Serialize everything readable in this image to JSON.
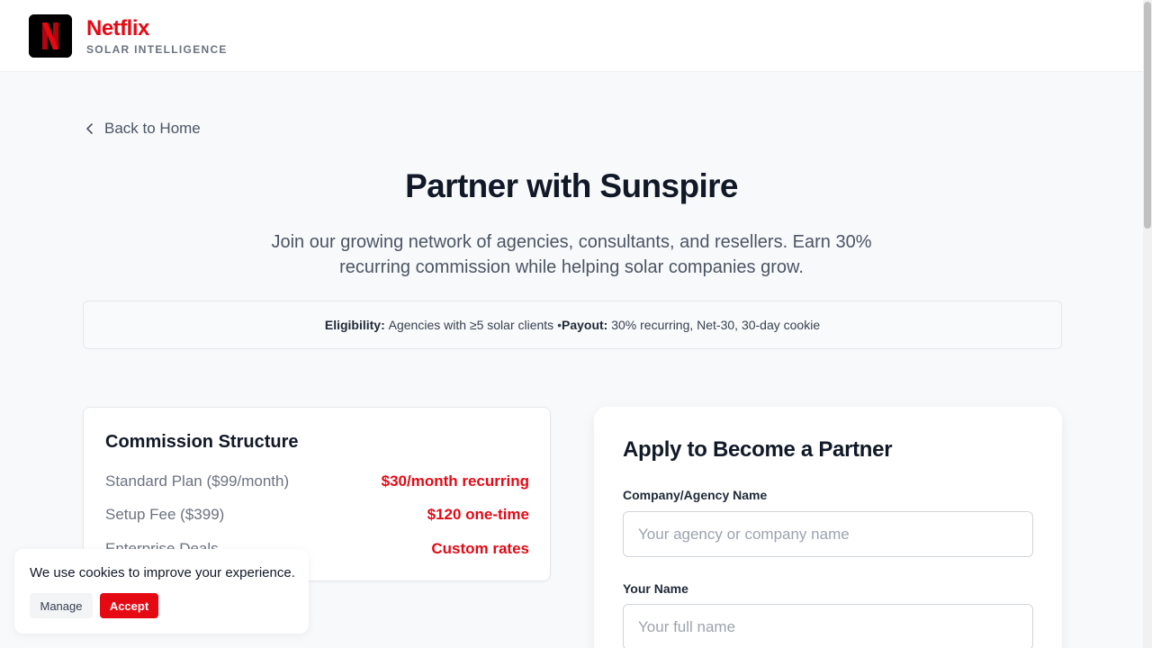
{
  "brand": {
    "name": "Netflix",
    "tagline": "SOLAR INTELLIGENCE",
    "logo_letter": "N",
    "accent_color": "#e50914"
  },
  "nav": {
    "back_label": "Back to Home",
    "back_icon": "chevron-left-icon"
  },
  "hero": {
    "title": "Partner with Sunspire",
    "subtitle": "Join our growing network of agencies, consultants, and resellers. Earn 30% recurring commission while helping solar companies grow."
  },
  "info_bar": {
    "eligibility_label": "Eligibility:",
    "eligibility_text": "Agencies with ≥5 solar clients",
    "separator": "•",
    "payout_label": "Payout:",
    "payout_text": "30% recurring, Net-30, 30-day cookie"
  },
  "commission": {
    "title": "Commission Structure",
    "rows": [
      {
        "label": "Standard Plan ($99/month)",
        "value": "$30/month recurring"
      },
      {
        "label": "Setup Fee ($399)",
        "value": "$120 one-time"
      },
      {
        "label": "Enterprise Deals",
        "value": "Custom rates"
      }
    ]
  },
  "form": {
    "title": "Apply to Become a Partner",
    "fields": [
      {
        "label": "Company/Agency Name",
        "placeholder": "Your agency or company name",
        "value": ""
      },
      {
        "label": "Your Name",
        "placeholder": "Your full name",
        "value": ""
      }
    ]
  },
  "cookie_banner": {
    "message": "We use cookies to improve your experience.",
    "manage_label": "Manage",
    "accept_label": "Accept"
  }
}
